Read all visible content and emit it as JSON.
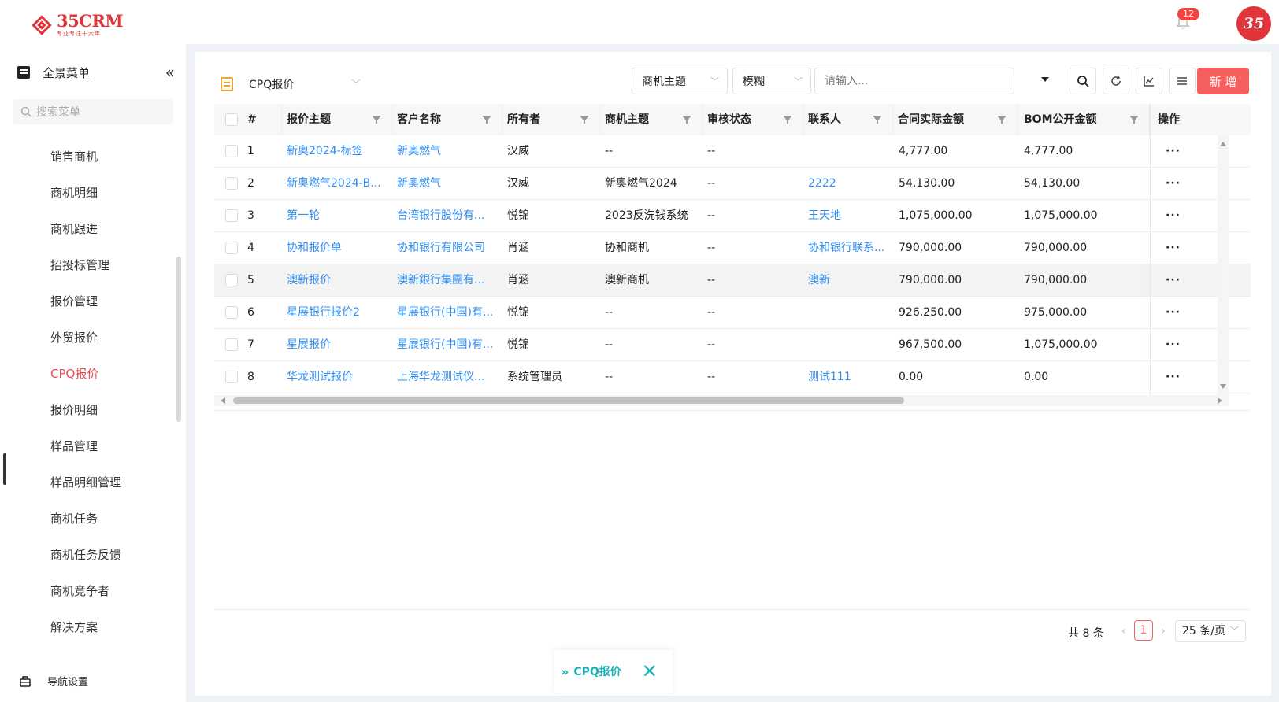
{
  "brand": {
    "name": "35CRM",
    "slogan": "专业专注十六年"
  },
  "header": {
    "notification_count": "12",
    "corner_logo": "35"
  },
  "sidebar": {
    "title": "全景菜单",
    "collapse_icon": "«",
    "search_placeholder": "搜索菜单",
    "items": [
      {
        "label": "销售商机"
      },
      {
        "label": "商机明细"
      },
      {
        "label": "商机跟进"
      },
      {
        "label": "招投标管理"
      },
      {
        "label": "报价管理"
      },
      {
        "label": "外贸报价"
      },
      {
        "label": "CPQ报价",
        "active": true
      },
      {
        "label": "报价明细"
      },
      {
        "label": "样品管理"
      },
      {
        "label": "样品明细管理"
      },
      {
        "label": "商机任务"
      },
      {
        "label": "商机任务反馈"
      },
      {
        "label": "商机竞争者"
      },
      {
        "label": "解决方案"
      }
    ],
    "nav_settings": "导航设置"
  },
  "toolbar": {
    "view_label": "CPQ报价",
    "field_select": "商机主题",
    "match_select": "模糊",
    "search_placeholder": "请输入...",
    "add_label": "新 增"
  },
  "table": {
    "columns": [
      "#",
      "报价主题",
      "客户名称",
      "所有者",
      "商机主题",
      "审核状态",
      "联系人",
      "合同实际金额",
      "BOM公开金额",
      "操作"
    ],
    "rows": [
      {
        "no": "1",
        "subject": "新奥2024-标签",
        "customer": "新奥燃气",
        "owner": "汉威",
        "opportunity": "--",
        "status": "--",
        "contact": "",
        "contract_amount": "4,777.00",
        "bom_amount": "4,777.00"
      },
      {
        "no": "2",
        "subject": "新奥燃气2024-B...",
        "customer": "新奥燃气",
        "owner": "汉威",
        "opportunity": "新奥燃气2024",
        "status": "--",
        "contact": "2222",
        "contract_amount": "54,130.00",
        "bom_amount": "54,130.00"
      },
      {
        "no": "3",
        "subject": "第一轮",
        "customer": "台湾银行股份有...",
        "owner": "悦锦",
        "opportunity": "2023反洗钱系统",
        "status": "--",
        "contact": "王天地",
        "contract_amount": "1,075,000.00",
        "bom_amount": "1,075,000.00"
      },
      {
        "no": "4",
        "subject": "协和报价单",
        "customer": "协和银行有限公司",
        "owner": "肖涵",
        "opportunity": "协和商机",
        "status": "--",
        "contact": "协和银行联系...",
        "contract_amount": "790,000.00",
        "bom_amount": "790,000.00"
      },
      {
        "no": "5",
        "subject": "澳新报价",
        "customer": "澳新銀行集團有...",
        "owner": "肖涵",
        "opportunity": "澳新商机",
        "status": "--",
        "contact": "澳新",
        "contract_amount": "790,000.00",
        "bom_amount": "790,000.00"
      },
      {
        "no": "6",
        "subject": "星展银行报价2",
        "customer": "星展银行(中国)有...",
        "owner": "悦锦",
        "opportunity": "--",
        "status": "--",
        "contact": "",
        "contract_amount": "926,250.00",
        "bom_amount": "975,000.00"
      },
      {
        "no": "7",
        "subject": "星展报价",
        "customer": "星展银行(中国)有...",
        "owner": "悦锦",
        "opportunity": "--",
        "status": "--",
        "contact": "",
        "contract_amount": "967,500.00",
        "bom_amount": "1,075,000.00"
      },
      {
        "no": "8",
        "subject": "华龙测试报价",
        "customer": "上海华龙测试仪...",
        "owner": "系统管理员",
        "opportunity": "--",
        "status": "--",
        "contact": "测试111",
        "contract_amount": "0.00",
        "bom_amount": "0.00"
      }
    ],
    "more_label": "···"
  },
  "pagination": {
    "total": "共 8 条",
    "current_page": "1",
    "page_size": "25 条/页"
  },
  "bottom_tab": {
    "label": "CPQ报价"
  },
  "colors": {
    "brand_red": "#e0353b",
    "link_blue": "#2f8df0",
    "add_button": "#f5605f",
    "tab_teal": "#1ab0b8"
  }
}
